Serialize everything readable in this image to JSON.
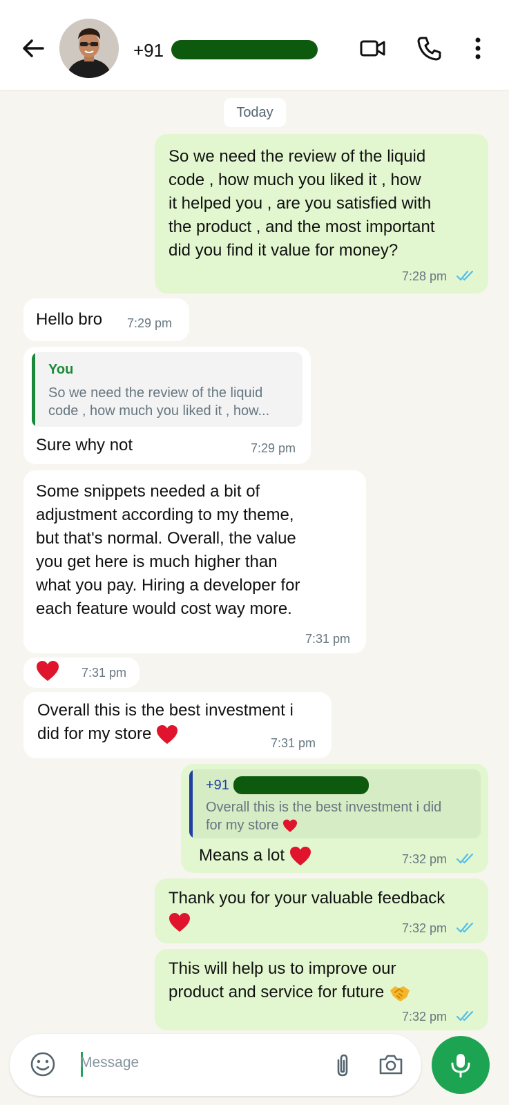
{
  "header": {
    "contact_prefix": "+91",
    "icons": [
      "back-arrow-icon",
      "video-call-icon",
      "phone-icon",
      "more-vertical-icon"
    ]
  },
  "date_chip": "Today",
  "messages": [
    {
      "direction": "out",
      "lines": [
        "So we need the review of the liquid",
        "code , how much you liked it , how",
        "it helped you , are you satisfied with",
        "the product , and the most important",
        "did you find it value for money?"
      ],
      "time": "7:28 pm",
      "status": "read"
    },
    {
      "direction": "in",
      "text": "Hello bro",
      "time": "7:29 pm"
    },
    {
      "direction": "in",
      "quote": {
        "name": "You",
        "lines": [
          "So we need the review of the liquid",
          "code , how much you liked it , how..."
        ]
      },
      "text": "Sure why not",
      "time": "7:29 pm"
    },
    {
      "direction": "in",
      "lines": [
        "Some snippets needed a bit of",
        "adjustment according to my theme,",
        "but that's normal. Overall, the value",
        "you get here is much higher than",
        "what you pay. Hiring a developer for",
        "each feature would cost way more."
      ],
      "time": "7:31 pm"
    },
    {
      "direction": "in",
      "emoji": "red-heart",
      "time": "7:31 pm"
    },
    {
      "direction": "in",
      "lines": [
        "Overall this is the best investment i",
        "did for my store"
      ],
      "emoji": "red-heart",
      "time": "7:31 pm"
    },
    {
      "direction": "out",
      "quote": {
        "name": "+91",
        "lines": [
          "Overall this is the best investment i did",
          "for my store"
        ],
        "emoji": "red-heart"
      },
      "text": "Means a lot",
      "emoji": "red-heart",
      "time": "7:32 pm",
      "status": "read"
    },
    {
      "direction": "out",
      "lines": [
        "Thank you for your valuable feedback"
      ],
      "emoji": "red-heart",
      "time": "7:32 pm",
      "status": "read"
    },
    {
      "direction": "out",
      "lines": [
        "This will help us to improve our",
        "product and service for future"
      ],
      "emoji": "handshake",
      "time": "7:32 pm",
      "status": "read"
    }
  ],
  "composer": {
    "placeholder": "Message",
    "icons": [
      "emoji-icon",
      "attach-icon",
      "camera-icon",
      "mic-icon"
    ]
  },
  "colors": {
    "outgoing_bubble": "#e2f7cf",
    "incoming_bubble": "#ffffff",
    "chat_background": "#f7f5f0",
    "tick_blue": "#53bdeb",
    "mic_green": "#1da452",
    "quote_green": "#1a8a3a",
    "quote_blue": "#1f3fa3"
  }
}
